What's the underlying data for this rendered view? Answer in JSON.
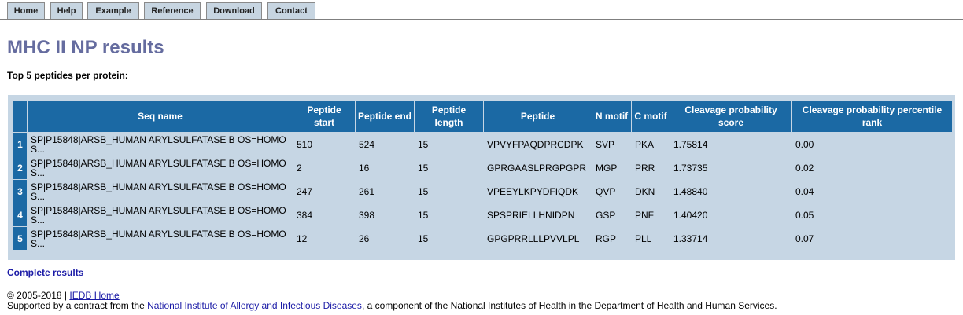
{
  "nav": {
    "tabs": [
      {
        "label": "Home"
      },
      {
        "label": "Help"
      },
      {
        "label": "Example"
      },
      {
        "label": "Reference"
      },
      {
        "label": "Download"
      },
      {
        "label": "Contact"
      }
    ]
  },
  "page": {
    "title": "MHC II NP results",
    "subtitle": "Top 5 peptides per protein:"
  },
  "table": {
    "headers": {
      "seq_name": "Seq name",
      "peptide_start": "Peptide start",
      "peptide_end": "Peptide end",
      "peptide_length": "Peptide length",
      "peptide": "Peptide",
      "n_motif": "N motif",
      "c_motif": "C motif",
      "cleavage_score": "Cleavage probability score",
      "cleavage_rank": "Cleavage probability percentile rank"
    },
    "rows": [
      {
        "num": "1",
        "seq": "SP|P15848|ARSB_HUMAN ARYLSULFATASE B OS=HOMO S...",
        "start": "510",
        "end": "524",
        "length": "15",
        "peptide": "VPVYFPAQDPRCDPK",
        "n_motif": "SVP",
        "c_motif": "PKA",
        "score": "1.75814",
        "rank": "0.00"
      },
      {
        "num": "2",
        "seq": "SP|P15848|ARSB_HUMAN ARYLSULFATASE B OS=HOMO S...",
        "start": "2",
        "end": "16",
        "length": "15",
        "peptide": "GPRGAASLPRGPGPR",
        "n_motif": "MGP",
        "c_motif": "PRR",
        "score": "1.73735",
        "rank": "0.02"
      },
      {
        "num": "3",
        "seq": "SP|P15848|ARSB_HUMAN ARYLSULFATASE B OS=HOMO S...",
        "start": "247",
        "end": "261",
        "length": "15",
        "peptide": "VPEEYLKPYDFIQDK",
        "n_motif": "QVP",
        "c_motif": "DKN",
        "score": "1.48840",
        "rank": "0.04"
      },
      {
        "num": "4",
        "seq": "SP|P15848|ARSB_HUMAN ARYLSULFATASE B OS=HOMO S...",
        "start": "384",
        "end": "398",
        "length": "15",
        "peptide": "SPSPRIELLHNIDPN",
        "n_motif": "GSP",
        "c_motif": "PNF",
        "score": "1.40420",
        "rank": "0.05"
      },
      {
        "num": "5",
        "seq": "SP|P15848|ARSB_HUMAN ARYLSULFATASE B OS=HOMO S...",
        "start": "12",
        "end": "26",
        "length": "15",
        "peptide": "GPGPRRLLLPVVLPL",
        "n_motif": "RGP",
        "c_motif": "PLL",
        "score": "1.33714",
        "rank": "0.07"
      }
    ]
  },
  "links": {
    "complete_results": "Complete results"
  },
  "footer": {
    "copyright": "© 2005-2018 | ",
    "iedb_home": "IEDB Home",
    "supported_prefix": "Supported by a contract from the ",
    "niaid": "National Institute of Allergy and Infectious Diseases",
    "supported_suffix": ", a component of the National Institutes of Health in the Department of Health and Human Services."
  }
}
